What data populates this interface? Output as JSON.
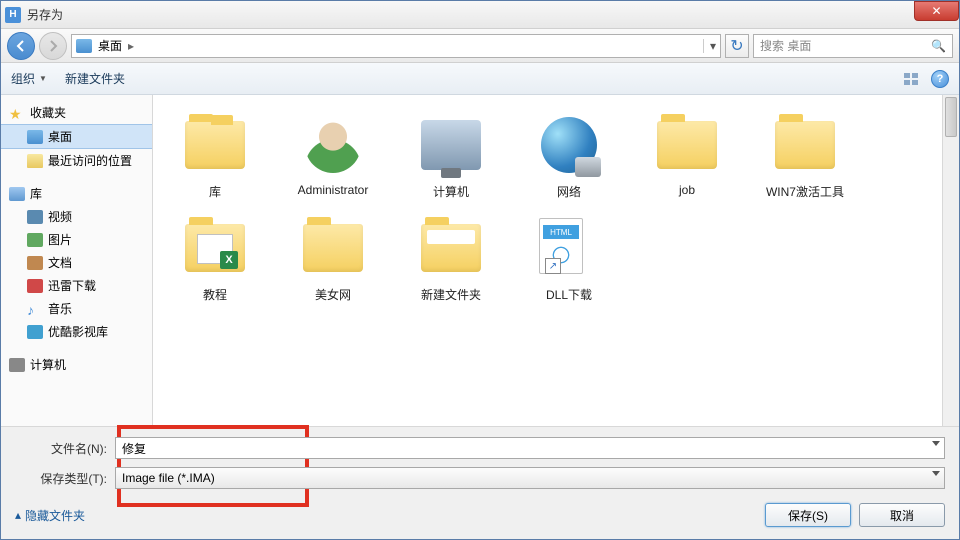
{
  "window": {
    "title": "另存为"
  },
  "nav": {
    "breadcrumb_location": "桌面",
    "breadcrumb_sep": "▸",
    "search_placeholder": "搜索 桌面"
  },
  "toolbar": {
    "organize": "组织",
    "new_folder": "新建文件夹"
  },
  "sidebar": {
    "favorites": "收藏夹",
    "desktop": "桌面",
    "recent": "最近访问的位置",
    "libraries": "库",
    "videos": "视频",
    "pictures": "图片",
    "documents": "文档",
    "xunlei": "迅雷下载",
    "music": "音乐",
    "youku": "优酷影视库",
    "computer": "计算机"
  },
  "items": [
    {
      "label": "库",
      "kind": "libraries"
    },
    {
      "label": "Administrator",
      "kind": "user"
    },
    {
      "label": "计算机",
      "kind": "computer"
    },
    {
      "label": "网络",
      "kind": "network"
    },
    {
      "label": "job",
      "kind": "folder"
    },
    {
      "label": "WIN7激活工具",
      "kind": "folder"
    },
    {
      "label": "教程",
      "kind": "folder-excel"
    },
    {
      "label": "美女网",
      "kind": "folder"
    },
    {
      "label": "新建文件夹",
      "kind": "folder-open"
    },
    {
      "label": "DLL下载",
      "kind": "html-shortcut"
    }
  ],
  "form": {
    "filename_label": "文件名(N):",
    "filename_value": "修复",
    "savetype_label": "保存类型(T):",
    "savetype_value": "Image file (*.IMA)"
  },
  "footer": {
    "hide_folders": "隐藏文件夹",
    "save": "保存(S)",
    "cancel": "取消"
  }
}
